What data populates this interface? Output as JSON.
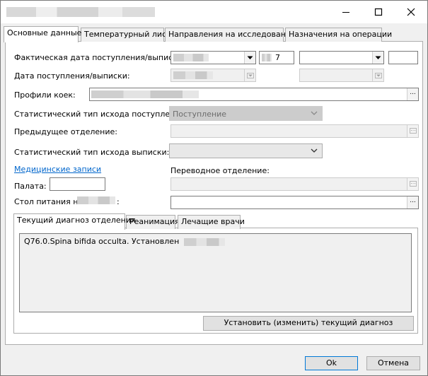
{
  "window": {
    "minimize_icon": "minimize-icon",
    "maximize_icon": "maximize-icon",
    "close_icon": "close-icon"
  },
  "tabs": [
    {
      "label": "Основные данные",
      "active": true
    },
    {
      "label": "Температурный лист"
    },
    {
      "label": "Направления на исследования"
    },
    {
      "label": "Назначения на операции"
    }
  ],
  "form": {
    "actual_date_label": "Фактическая дата поступления/выписки:",
    "actual_time_partial": "7",
    "admission_date_label": "Дата поступления/выписки:",
    "bed_profiles_label": "Профили коек:",
    "stat_outcome_admission_label": "Статистический тип исхода поступления:",
    "stat_outcome_admission_value": "Поступление",
    "prev_department_label": "Предыдущее отделение:",
    "stat_outcome_discharge_label": "Статистический тип исхода выписки:",
    "medical_records_link": "Медицинские записи",
    "transfer_department_label": "Переводное отделение:",
    "ward_label": "Палата:",
    "diet_label_prefix": "Стол питания на",
    "diet_label_suffix": ":"
  },
  "subtabs": [
    {
      "label": "Текущий диагноз отделения",
      "active": true
    },
    {
      "label": "Реанимация"
    },
    {
      "label": "Лечащие врачи"
    }
  ],
  "diagnosis": {
    "text": "Q76.0.Spina bifida occulta. Установлен",
    "set_button": "Установить (изменить) текущий диагноз"
  },
  "footer": {
    "ok": "Ok",
    "cancel": "Отмена"
  }
}
